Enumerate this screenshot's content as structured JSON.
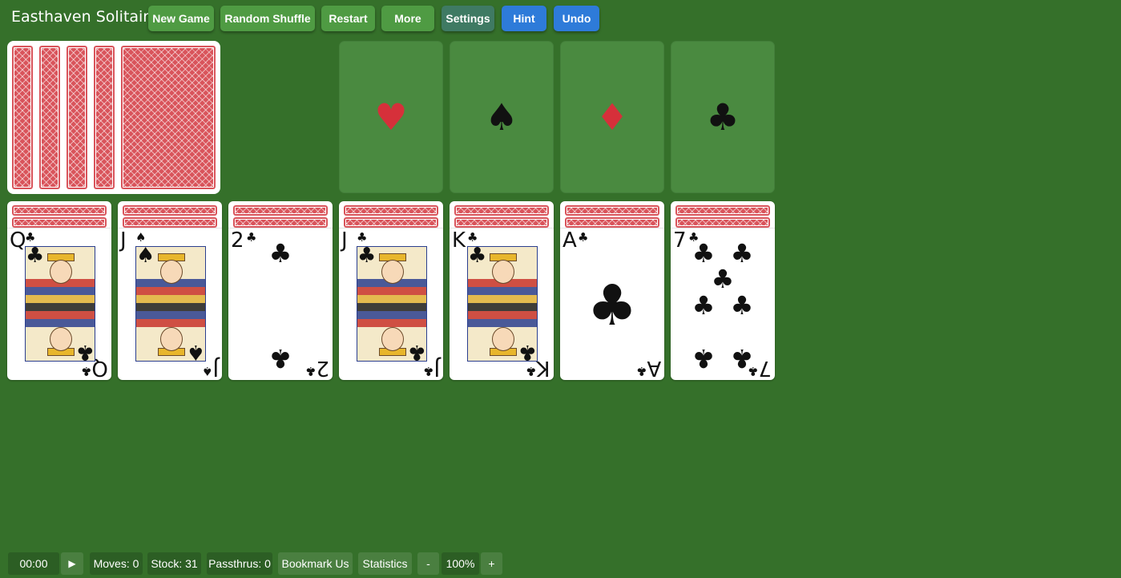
{
  "app": {
    "title": "Easthaven Solitaire"
  },
  "toolbar": {
    "new_game": "New Game",
    "random_shuffle": "Random Shuffle",
    "restart": "Restart",
    "more": "More",
    "settings": "Settings",
    "hint": "Hint",
    "undo": "Undo"
  },
  "colors": {
    "felt": "#35702a",
    "slot": "#4a8a40",
    "card_back": "#d9545b",
    "button_green": "#4f9b43",
    "button_blue": "#2e7bd9",
    "button_teal": "#3f7a63",
    "red_suit": "#d6303a",
    "black_suit": "#111111"
  },
  "stock": {
    "visible_backs": 5
  },
  "foundations": [
    {
      "suit": "hearts",
      "glyph": "♥",
      "color": "#d6303a"
    },
    {
      "suit": "spades",
      "glyph": "♠",
      "color": "#111111"
    },
    {
      "suit": "diamonds",
      "glyph": "♦",
      "color": "#d6303a"
    },
    {
      "suit": "clubs",
      "glyph": "♣",
      "color": "#111111"
    }
  ],
  "tableau": [
    {
      "rank": "Q",
      "suit": "♣",
      "face_down_count": 2,
      "kind": "court"
    },
    {
      "rank": "J",
      "suit": "♠",
      "face_down_count": 2,
      "kind": "court"
    },
    {
      "rank": "2",
      "suit": "♣",
      "face_down_count": 2,
      "kind": "pips"
    },
    {
      "rank": "J",
      "suit": "♣",
      "face_down_count": 2,
      "kind": "court"
    },
    {
      "rank": "K",
      "suit": "♣",
      "face_down_count": 2,
      "kind": "court"
    },
    {
      "rank": "A",
      "suit": "♣",
      "face_down_count": 2,
      "kind": "ace"
    },
    {
      "rank": "7",
      "suit": "♣",
      "face_down_count": 2,
      "kind": "pips"
    }
  ],
  "status": {
    "timer": "00:00",
    "play_glyph": "▶",
    "moves": "Moves: 0",
    "stock": "Stock: 31",
    "passthrus": "Passthrus: 0",
    "bookmark": "Bookmark Us",
    "statistics": "Statistics",
    "zoom_out": "-",
    "zoom": "100%",
    "zoom_in": "+"
  }
}
